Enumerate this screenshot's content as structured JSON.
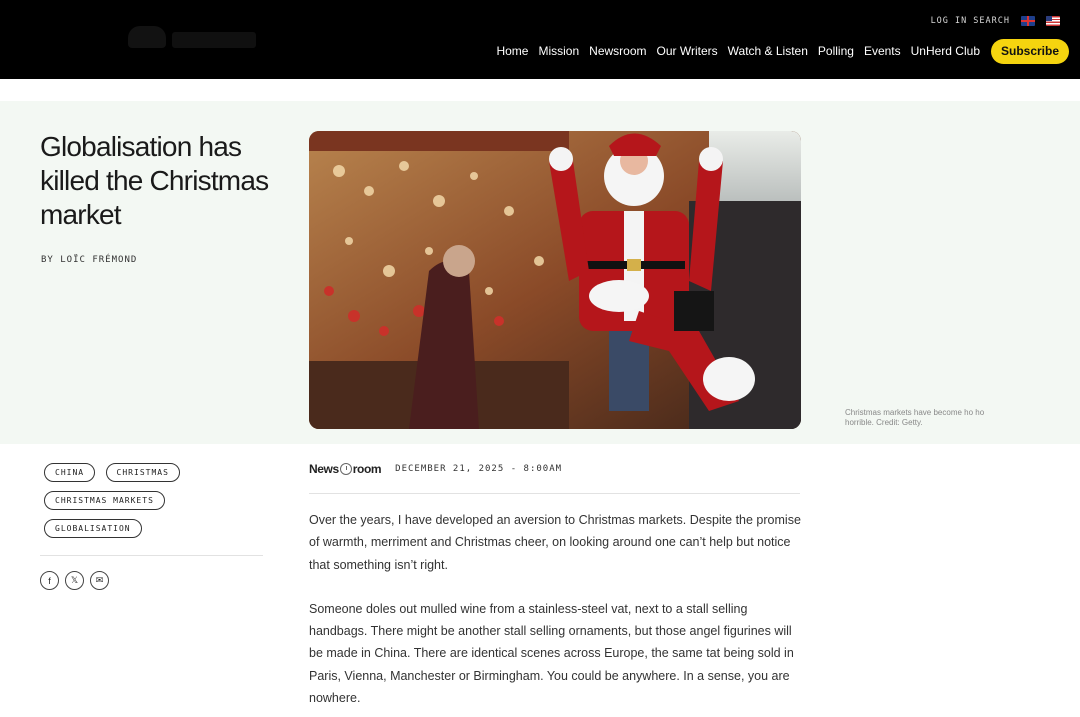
{
  "header": {
    "util_links": [
      "LOG IN",
      "SEARCH"
    ],
    "nav": [
      "Home",
      "Mission",
      "Newsroom",
      "Our Writers",
      "Watch & Listen",
      "Polling",
      "Events",
      "UnHerd Club"
    ],
    "subscribe": "Subscribe"
  },
  "article": {
    "title": "Globalisation has killed the Christmas market",
    "byline": "BY LOÏC FRÉMOND",
    "caption": "Christmas markets have become ho ho horrible. Credit: Getty.",
    "tags": [
      "CHINA",
      "CHRISTMAS",
      "CHRISTMAS MARKETS",
      "GLOBALISATION"
    ],
    "brand_left": "News",
    "brand_right": "room",
    "date": "DECEMBER 21, 2025 - 8:00AM",
    "paragraphs": [
      "Over the years, I have developed an aversion to Christmas markets. Despite the promise of warmth, merriment and Christmas cheer, on looking around one can’t help but notice that something isn’t right.",
      "Someone doles out mulled wine from a stainless-steel vat, next to a stall selling handbags. There might be another stall selling ornaments, but those angel figurines will be made in China. There are identical scenes across Europe, the same tat being sold in Paris, Vienna, Manchester or Birmingham. You could be anywhere. In a sense, you are nowhere."
    ]
  },
  "share": {
    "facebook": "f",
    "x": "𝕏",
    "email": "✉"
  },
  "colors": {
    "header_bg": "#000000",
    "subscribe_bg": "#f5d40f",
    "hero_bg": "#f3f8f3"
  }
}
